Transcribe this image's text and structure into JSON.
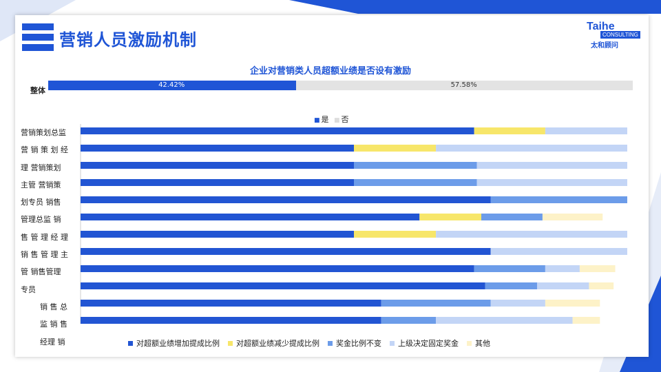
{
  "header": {
    "title": "营销人员激励机制"
  },
  "logo": {
    "brand": "Taihe",
    "sub": "CONSULTING",
    "cn": "太和顾问"
  },
  "colors": {
    "accent": "#1f55d6",
    "yes": "#1f55d6",
    "no": "#e3e3e3",
    "s1": "#2255d3",
    "s2": "#f7e66a",
    "s3": "#6c9ce9",
    "s4": "#c3d5f6",
    "s5": "#fdf2c8"
  },
  "chart_data": [
    {
      "type": "bar",
      "title": "企业对营销类人员超额业绩是否设有激励",
      "categories": [
        "整体"
      ],
      "series": [
        {
          "name": "是",
          "values": [
            42.42
          ],
          "label": "42.42%"
        },
        {
          "name": "否",
          "values": [
            57.58
          ],
          "label": "57.58%"
        }
      ],
      "legend": [
        "是",
        "否"
      ]
    },
    {
      "type": "bar",
      "stacked": true,
      "orientation": "horizontal",
      "category_text": [
        "营销策划总监",
        "营 销 策 划 经",
        "理   营销策划",
        "主管   营销策",
        "划专员   销售",
        "管理总监   销",
        "售 管 理 经 理",
        "销 售 管 理 主",
        "管   销售管理",
        "专员",
        "销   售   总",
        "监   销   售",
        "经理   销"
      ],
      "rows": 12,
      "series": [
        {
          "name": "对超额业绩增加提成比例",
          "values": [
            0.72,
            0.5,
            0.5,
            0.5,
            0.75,
            0.62,
            0.5,
            0.75,
            0.72,
            0.74,
            0.55,
            0.55
          ]
        },
        {
          "name": "对超额业绩减少提成比例",
          "values": [
            0.13,
            0.15,
            0,
            0,
            0,
            0.113,
            0.15,
            0,
            0,
            0,
            0,
            0
          ]
        },
        {
          "name": "奖金比例不变",
          "values": [
            0,
            0,
            0.225,
            0.225,
            0.25,
            0.112,
            0,
            0,
            0.13,
            0.095,
            0.2,
            0.1
          ]
        },
        {
          "name": "上级决定固定奖金",
          "values": [
            0.15,
            0.35,
            0.275,
            0.275,
            0,
            0,
            0.35,
            0.25,
            0.063,
            0.095,
            0.1,
            0.25
          ]
        },
        {
          "name": "其他",
          "values": [
            0,
            0,
            0,
            0,
            0,
            0.11,
            0,
            0,
            0.065,
            0.045,
            0.1,
            0.05
          ]
        }
      ]
    }
  ]
}
